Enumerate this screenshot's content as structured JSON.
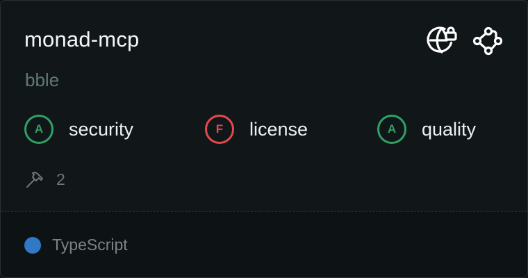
{
  "card": {
    "title": "monad-mcp",
    "subtitle": "bble",
    "icons": [
      "globe-lock-icon",
      "route-nodes-icon"
    ]
  },
  "scores": [
    {
      "grade": "A",
      "label": "security",
      "status": "pass",
      "color": "#2ea165"
    },
    {
      "grade": "F",
      "label": "license",
      "status": "fail",
      "color": "#e5484d"
    },
    {
      "grade": "A",
      "label": "quality",
      "status": "pass",
      "color": "#2ea165"
    }
  ],
  "tools": {
    "icon": "hammer-icon",
    "count": "2"
  },
  "footer": {
    "language": "TypeScript",
    "language_color": "#3178c6"
  }
}
